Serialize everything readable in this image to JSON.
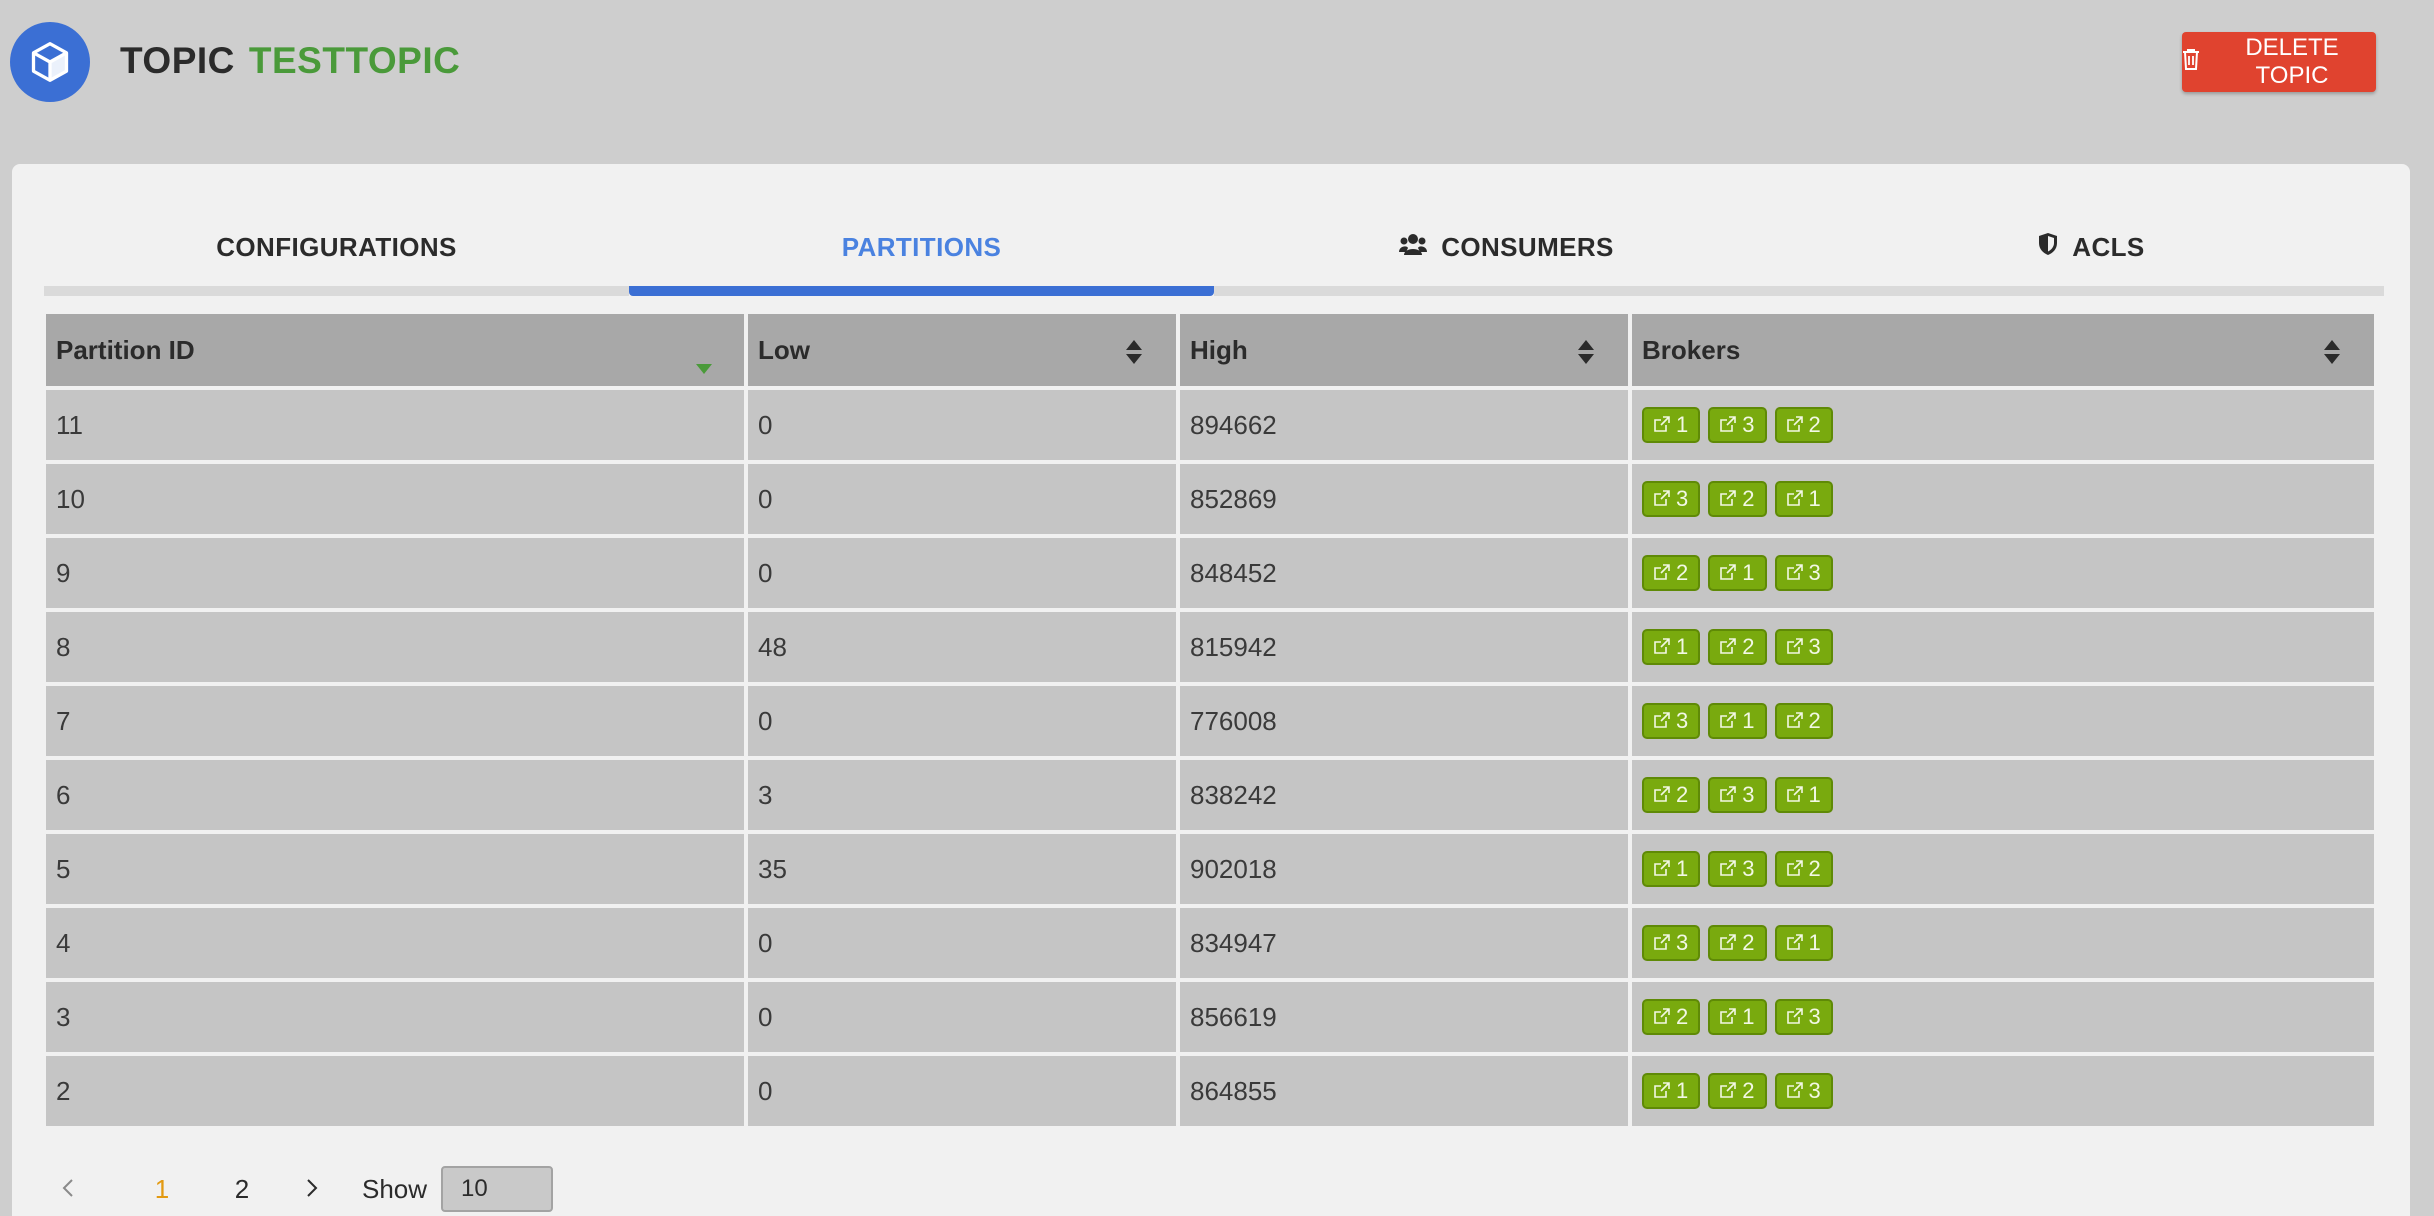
{
  "header": {
    "title_label": "TOPIC",
    "topic_name": "TESTTOPIC",
    "delete_label": "DELETE TOPIC"
  },
  "tabs": [
    {
      "label": "CONFIGURATIONS",
      "active": false,
      "icon": ""
    },
    {
      "label": "PARTITIONS",
      "active": true,
      "icon": ""
    },
    {
      "label": "CONSUMERS",
      "active": false,
      "icon": "users-icon"
    },
    {
      "label": "ACLS",
      "active": false,
      "icon": "shield-icon"
    }
  ],
  "table": {
    "columns": [
      "Partition ID",
      "Low",
      "High",
      "Brokers"
    ],
    "rows": [
      {
        "id": "11",
        "low": "0",
        "high": "894662",
        "brokers": [
          "1",
          "3",
          "2"
        ]
      },
      {
        "id": "10",
        "low": "0",
        "high": "852869",
        "brokers": [
          "3",
          "2",
          "1"
        ]
      },
      {
        "id": "9",
        "low": "0",
        "high": "848452",
        "brokers": [
          "2",
          "1",
          "3"
        ]
      },
      {
        "id": "8",
        "low": "48",
        "high": "815942",
        "brokers": [
          "1",
          "2",
          "3"
        ]
      },
      {
        "id": "7",
        "low": "0",
        "high": "776008",
        "brokers": [
          "3",
          "1",
          "2"
        ]
      },
      {
        "id": "6",
        "low": "3",
        "high": "838242",
        "brokers": [
          "2",
          "3",
          "1"
        ]
      },
      {
        "id": "5",
        "low": "35",
        "high": "902018",
        "brokers": [
          "1",
          "3",
          "2"
        ]
      },
      {
        "id": "4",
        "low": "0",
        "high": "834947",
        "brokers": [
          "3",
          "2",
          "1"
        ]
      },
      {
        "id": "3",
        "low": "0",
        "high": "856619",
        "brokers": [
          "2",
          "1",
          "3"
        ]
      },
      {
        "id": "2",
        "low": "0",
        "high": "864855",
        "brokers": [
          "1",
          "2",
          "3"
        ]
      }
    ]
  },
  "pagination": {
    "pages": [
      "1",
      "2"
    ],
    "current": "1",
    "show_label": "Show",
    "page_size": "10"
  },
  "colors": {
    "accent": "#3b6fd4",
    "topic_name": "#4a9a3a",
    "delete": "#e0432f",
    "broker_badge": "#79aa0e",
    "current_page": "#e39a12"
  }
}
